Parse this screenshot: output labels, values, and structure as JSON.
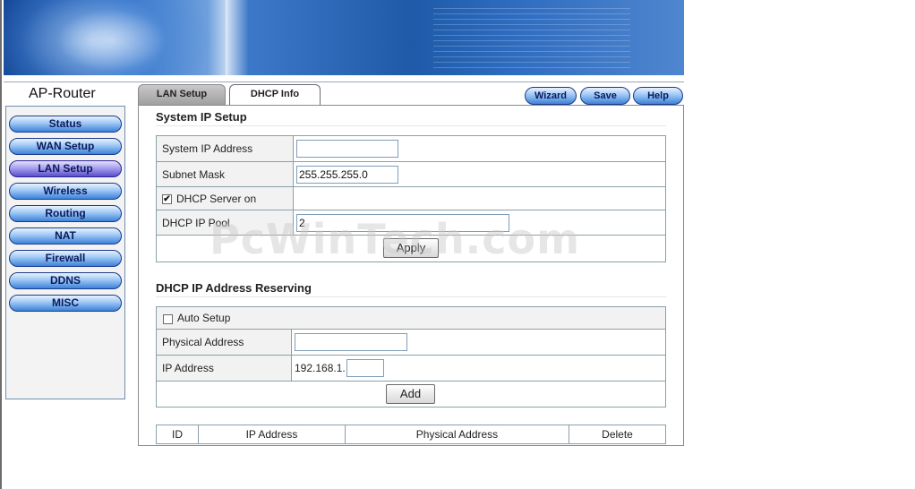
{
  "brand": "AP-Router",
  "sidebar": {
    "items": [
      {
        "label": "Status"
      },
      {
        "label": "WAN Setup"
      },
      {
        "label": "LAN Setup"
      },
      {
        "label": "Wireless"
      },
      {
        "label": "Routing"
      },
      {
        "label": "NAT"
      },
      {
        "label": "Firewall"
      },
      {
        "label": "DDNS"
      },
      {
        "label": "MISC"
      }
    ],
    "active": "LAN Setup"
  },
  "tabs": [
    {
      "label": "LAN Setup"
    },
    {
      "label": "DHCP Info"
    }
  ],
  "toolbar": {
    "wizard": "Wizard",
    "save": "Save",
    "help": "Help"
  },
  "system_ip": {
    "title": "System IP Setup",
    "ip_label": "System IP Address",
    "ip_value": "",
    "mask_label": "Subnet Mask",
    "mask_value": "255.255.255.0",
    "dhcp_label": "DHCP Server on",
    "dhcp_checked": true,
    "dhcp_check_mark": "✔",
    "pool_label": "DHCP IP Pool",
    "pool_value": "2",
    "apply": "Apply"
  },
  "reserving": {
    "title": "DHCP IP Address Reserving",
    "auto_label": "Auto Setup",
    "auto_checked": false,
    "mac_label": "Physical Address",
    "mac_value": "",
    "ip_label": "IP Address",
    "ip_prefix": "192.168.1.",
    "ip_suffix": "",
    "add": "Add"
  },
  "table": {
    "headers": [
      "ID",
      "IP Address",
      "Physical Address",
      "Delete"
    ]
  },
  "watermark": "PcWinTech.com",
  "colors": {
    "nav_button": "#3c82d8",
    "nav_active": "#5a4fc9",
    "banner": "#1e5aa8"
  }
}
